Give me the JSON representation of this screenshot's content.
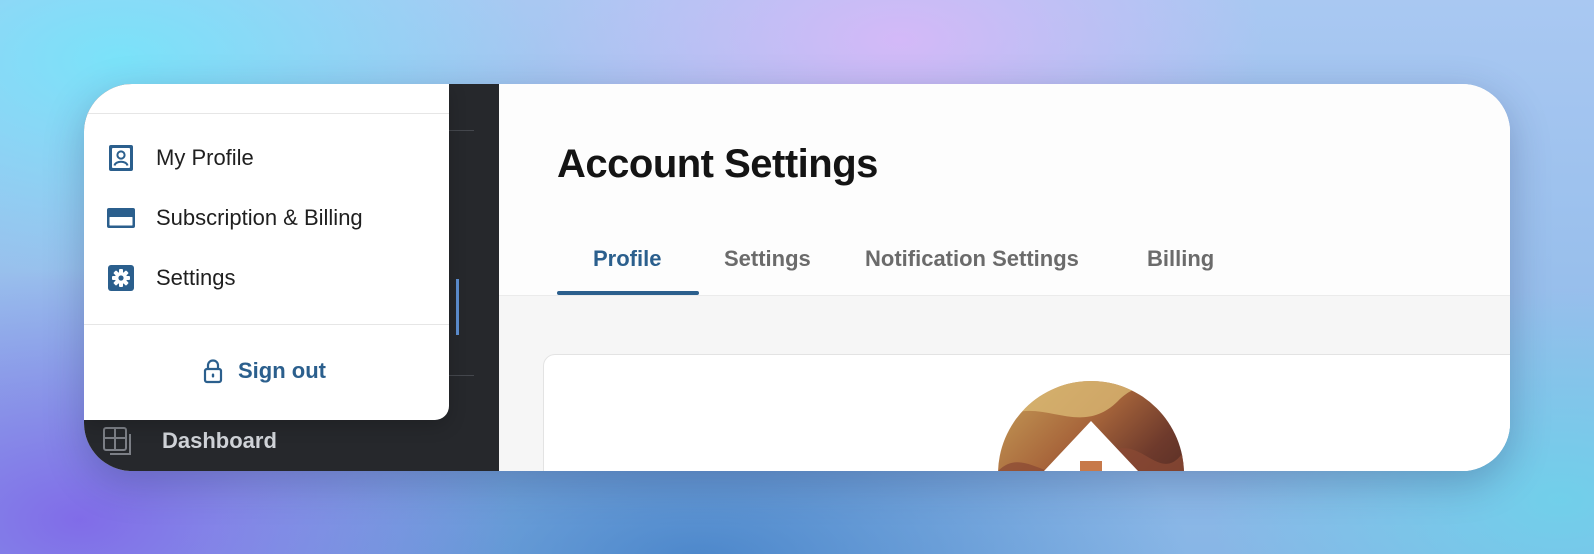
{
  "colors": {
    "accent": "#2b5f8d",
    "sidebar_bg": "#26282c",
    "text_dark": "#141414",
    "tab_inactive": "#6b6b6b"
  },
  "user_menu": {
    "items": [
      {
        "label": "My Profile",
        "icon": "profile-card-icon"
      },
      {
        "label": "Subscription & Billing",
        "icon": "credit-card-icon"
      },
      {
        "label": "Settings",
        "icon": "gear-icon"
      }
    ],
    "sign_out": {
      "label": "Sign out",
      "icon": "lock-icon"
    }
  },
  "sidebar": {
    "items": [
      {
        "label": "Dashboard",
        "icon": "dashboard-icon"
      }
    ]
  },
  "main": {
    "title": "Account Settings",
    "tabs": [
      {
        "label": "Profile",
        "active": true
      },
      {
        "label": "Settings",
        "active": false
      },
      {
        "label": "Notification Settings",
        "active": false
      },
      {
        "label": "Billing",
        "active": false
      }
    ],
    "profile_card": {
      "avatar": "user-avatar-photo"
    }
  }
}
